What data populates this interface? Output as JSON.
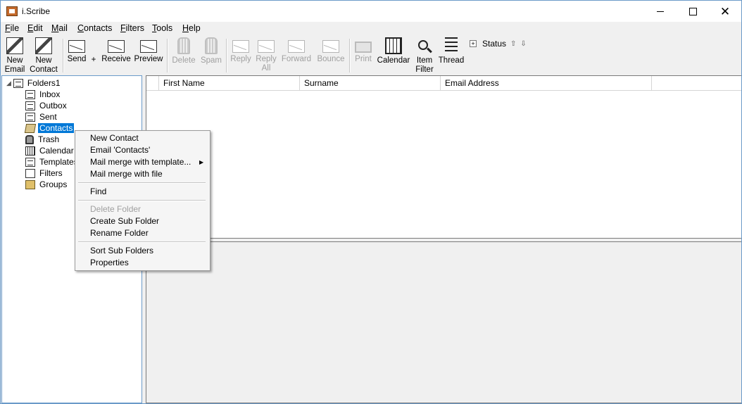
{
  "window": {
    "title": "i.Scribe"
  },
  "menubar": [
    {
      "label": "File",
      "u": "F",
      "rest": "ile"
    },
    {
      "label": "Edit",
      "u": "E",
      "rest": "dit"
    },
    {
      "label": "Mail",
      "u": "M",
      "rest": "ail"
    },
    {
      "label": "Contacts",
      "u": "C",
      "rest": "ontacts"
    },
    {
      "label": "Filters",
      "u": "F",
      "rest": "ilters"
    },
    {
      "label": "Tools",
      "u": "T",
      "rest": "ools"
    },
    {
      "label": "Help",
      "u": "H",
      "rest": "elp"
    }
  ],
  "toolbar": {
    "new_email": [
      "New",
      "Email"
    ],
    "new_contact": [
      "New",
      "Contact"
    ],
    "send": "Send",
    "plus": "+",
    "receive": "Receive",
    "preview": "Preview",
    "delete": "Delete",
    "spam": "Spam",
    "reply": "Reply",
    "reply_all": [
      "Reply",
      "All"
    ],
    "forward": "Forward",
    "bounce": "Bounce",
    "print": "Print",
    "calendar": "Calendar",
    "item_filter": [
      "Item",
      "Filter"
    ],
    "thread": "Thread",
    "status": "Status",
    "status_expand": "+",
    "arrow_up": "⇧",
    "arrow_down": "⇩"
  },
  "folders": {
    "root": "Folders1",
    "items": [
      "Inbox",
      "Outbox",
      "Sent",
      "Contacts",
      "Trash",
      "Calendar",
      "Templates",
      "Filters",
      "Groups"
    ],
    "selected": "Contacts"
  },
  "list": {
    "columns": [
      "First Name",
      "Surname",
      "Email Address"
    ]
  },
  "context_menu": {
    "items": [
      "New Contact",
      "Email 'Contacts'",
      "Mail merge with template...",
      "Mail merge with file",
      "Find",
      "Delete Folder",
      "Create Sub Folder",
      "Rename Folder",
      "Sort Sub Folders",
      "Properties"
    ],
    "submenu_arrow": "▶"
  }
}
